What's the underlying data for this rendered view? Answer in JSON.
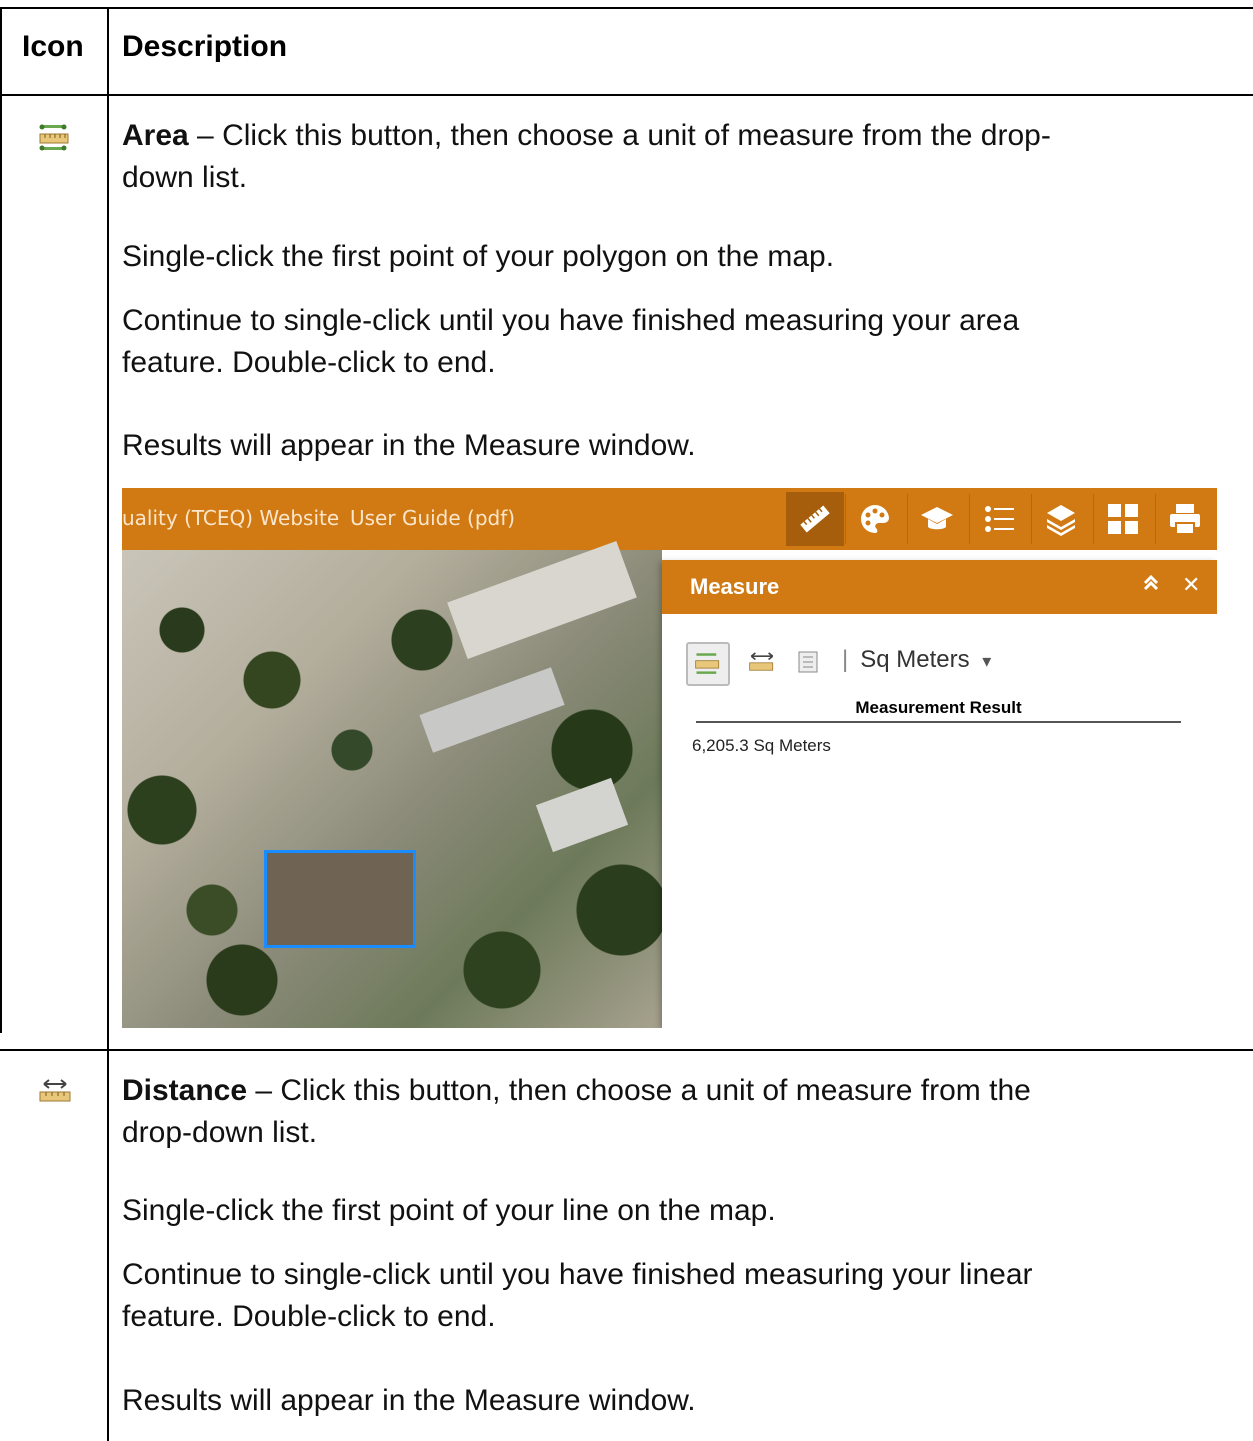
{
  "table": {
    "col_icon_header": "Icon",
    "col_desc_header": "Description"
  },
  "rows": [
    {
      "icon": "area-measure-icon",
      "title": "Area",
      "lines": [
        " – Click this button, then choose a unit of measure from the drop-",
        "down list.",
        "Single-click the first point of your polygon on the map.",
        "Continue to single-click until you have finished measuring your area",
        "feature. Double-click to end.",
        "Results will appear in the Measure window."
      ]
    },
    {
      "icon": "distance-measure-icon",
      "title": "Distance",
      "lines": [
        " – Click this button, then choose a unit of measure from the",
        "drop-down list.",
        "Single-click the first point of your line on the map.",
        "Continue to single-click until you have finished measuring your linear",
        "feature. Double-click to end.",
        "Results will appear in the Measure window."
      ]
    }
  ],
  "screenshot": {
    "topbar_link_1": "uality (TCEQ) Website",
    "topbar_link_2": "User Guide (pdf)",
    "toolbar_icons": [
      "ruler-icon",
      "palette-icon",
      "graduation-cap-icon",
      "legend-list-icon",
      "layers-icon",
      "grid-icon",
      "printer-icon"
    ],
    "panel": {
      "title": "Measure",
      "collapse_glyph": "≈",
      "close_glyph": "✕",
      "unit_separator": "|",
      "unit_label": "Sq Meters",
      "unit_caret": "▾",
      "result_header": "Measurement Result",
      "result_value": "6,205.3 Sq Meters"
    },
    "accent_color": "#d17a14"
  }
}
